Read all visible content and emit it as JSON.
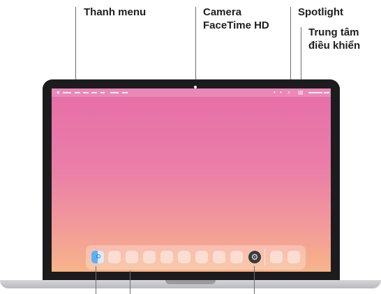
{
  "callouts": {
    "menu_bar": "Thanh menu",
    "camera_line1": "Camera",
    "camera_line2": "FaceTime HD",
    "spotlight": "Spotlight",
    "control_center_line1": "Trung tâm",
    "control_center_line2": "điều khiển"
  },
  "icons": {
    "camera": "camera-dot",
    "spotlight": "search-icon",
    "control_center": "control-center-icon",
    "finder": "finder-icon",
    "settings": "system-settings-icon"
  },
  "colors": {
    "screen_top": "#e66ea8",
    "screen_bottom": "#f7b488",
    "bezel": "#1c1c1e"
  }
}
